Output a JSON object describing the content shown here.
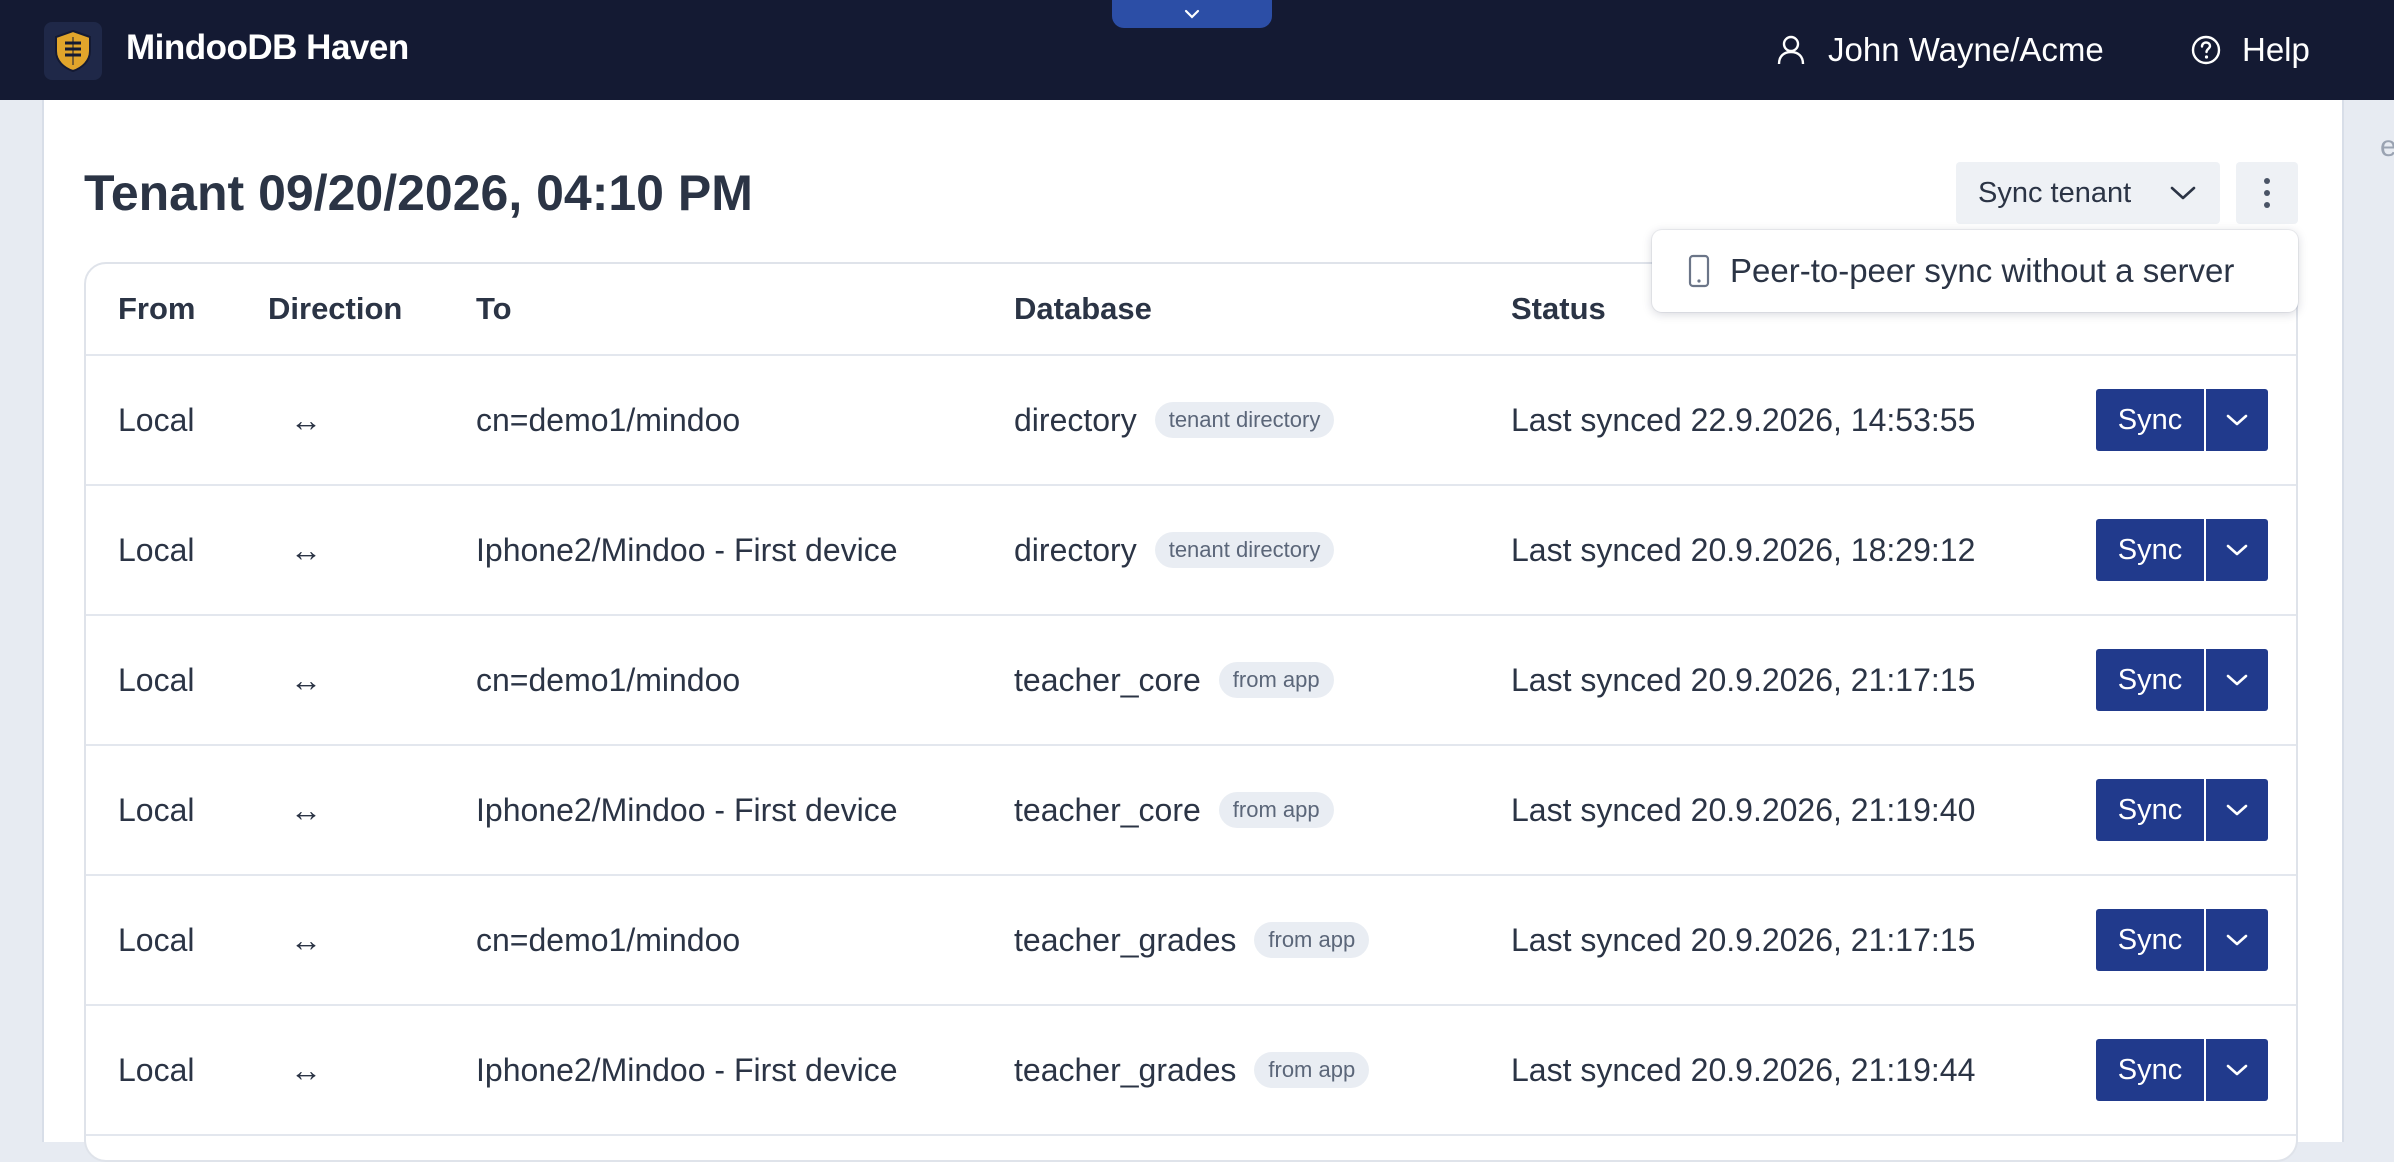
{
  "app": {
    "title": "MindooDB Haven",
    "logo_icon": "shield-logo-icon"
  },
  "header": {
    "user_label": "John Wayne/Acme",
    "help_label": "Help"
  },
  "page": {
    "title": "Tenant 09/20/2026, 04:10 PM",
    "sync_tenant_label": "Sync tenant"
  },
  "menu": {
    "items": [
      {
        "label": "Peer-to-peer sync without a server",
        "icon": "phone-icon"
      }
    ]
  },
  "table": {
    "columns": [
      "From",
      "Direction",
      "To",
      "Database",
      "Status",
      ""
    ],
    "rows": [
      {
        "from": "Local",
        "direction": "↔",
        "to": "cn=demo1/mindoo",
        "database": "directory",
        "badge": "tenant directory",
        "status": "Last synced 22.9.2026, 14:53:55",
        "action": "Sync"
      },
      {
        "from": "Local",
        "direction": "↔",
        "to": "Iphone2/Mindoo - First device",
        "database": "directory",
        "badge": "tenant directory",
        "status": "Last synced 20.9.2026, 18:29:12",
        "action": "Sync"
      },
      {
        "from": "Local",
        "direction": "↔",
        "to": "cn=demo1/mindoo",
        "database": "teacher_core",
        "badge": "from app",
        "status": "Last synced 20.9.2026, 21:17:15",
        "action": "Sync"
      },
      {
        "from": "Local",
        "direction": "↔",
        "to": "Iphone2/Mindoo - First device",
        "database": "teacher_core",
        "badge": "from app",
        "status": "Last synced 20.9.2026, 21:19:40",
        "action": "Sync"
      },
      {
        "from": "Local",
        "direction": "↔",
        "to": "cn=demo1/mindoo",
        "database": "teacher_grades",
        "badge": "from app",
        "status": "Last synced 20.9.2026, 21:17:15",
        "action": "Sync"
      },
      {
        "from": "Local",
        "direction": "↔",
        "to": "Iphone2/Mindoo - First device",
        "database": "teacher_grades",
        "badge": "from app",
        "status": "Last synced 20.9.2026, 21:19:44",
        "action": "Sync"
      }
    ]
  },
  "colors": {
    "topbar": "#141a33",
    "primary": "#213a8c",
    "background": "#e7ebf2"
  }
}
